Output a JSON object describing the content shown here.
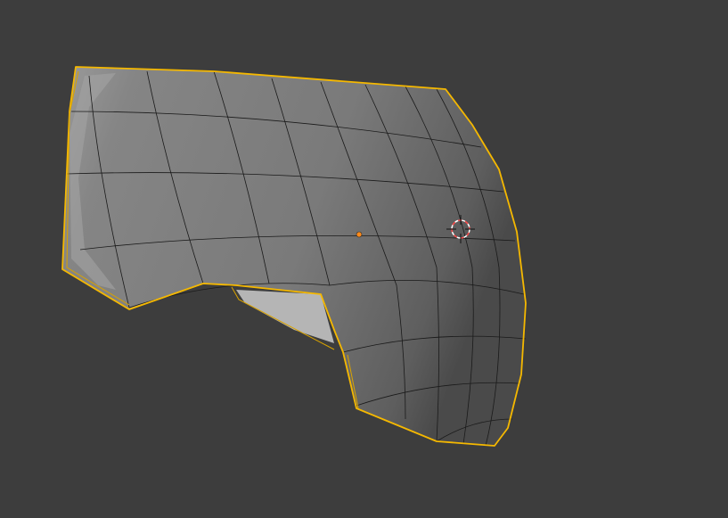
{
  "viewport": {
    "background_color": "#3d3d3d",
    "mesh_fill_color": "#7d7d7d",
    "selection_outline_color": "#f5b800",
    "wire_color": "#1a1a1a",
    "origin_color": "#ff8a1a",
    "cursor_colors": [
      "#ff4a4a",
      "#ffffff"
    ]
  },
  "object": {
    "name_visible": false,
    "selected": true
  }
}
